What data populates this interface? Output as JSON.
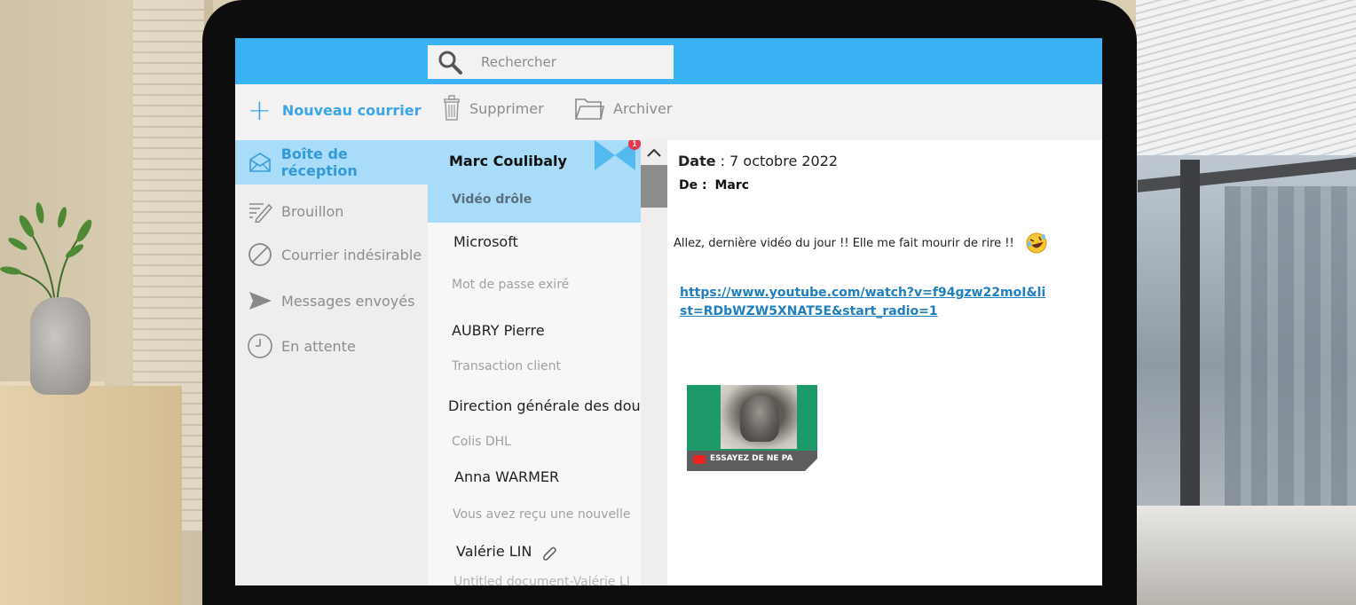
{
  "search": {
    "placeholder": "Rechercher"
  },
  "toolbar": {
    "new_mail_label": "Nouveau courrier",
    "delete_label": "Supprimer",
    "archive_label": "Archiver"
  },
  "sidebar": {
    "items": [
      {
        "label": "Boîte de réception",
        "icon": "inbox-envelope-icon",
        "active": true
      },
      {
        "label": "Brouillon",
        "icon": "draft-pen-icon"
      },
      {
        "label": "Courrier indésirable",
        "icon": "blocked-icon"
      },
      {
        "label": "Messages envoyés",
        "icon": "send-icon"
      },
      {
        "label": "En attente",
        "icon": "clock-icon"
      }
    ]
  },
  "messages": [
    {
      "sender": "Marc Coulibaly",
      "subject": "Vidéo drôle",
      "active": true,
      "badge": "1"
    },
    {
      "sender": "Microsoft",
      "subject": "Mot de passe exiré"
    },
    {
      "sender": "AUBRY Pierre",
      "subject": "Transaction client"
    },
    {
      "sender": "Direction générale des dou",
      "subject": "Colis DHL"
    },
    {
      "sender": "Anna WARMER",
      "subject": "Vous avez reçu une nouvelle"
    },
    {
      "sender": "Valérie LIN",
      "subject": "Untitled document-Valérie LI",
      "attachment": true
    }
  ],
  "reading": {
    "date_label": "Date",
    "date_value": " : 7 octobre 2022",
    "from_label": "De :",
    "from_value": "Marc",
    "body": "Allez, dernière vidéo du jour !! Elle me fait mourir de rire !!",
    "emoji": "rolling-on-floor-laughing-emoji",
    "link": "https://www.youtube.com/watch?v=f94gzw22moI&list=RDbWZW5XNAT5E&start_radio=1",
    "video_thumbnail_title": "ESSAYEZ DE NE PA"
  },
  "colors": {
    "accent": "#39b3f3",
    "active_row": "#a9dcf9",
    "link": "#1f7fbf",
    "badge": "#e8374a"
  }
}
